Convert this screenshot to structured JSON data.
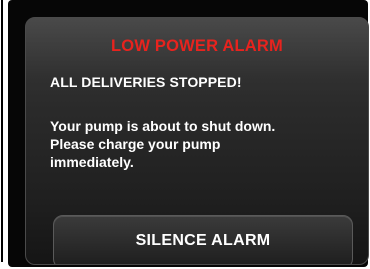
{
  "alarm": {
    "title": "LOW POWER ALARM",
    "title_color": "#e8231e",
    "subtitle": "ALL DELIVERIES STOPPED!",
    "message_lines": [
      "Your pump is about to shut down.",
      "Please charge your pump",
      "immediately."
    ]
  },
  "actions": {
    "silence_label": "SILENCE ALARM"
  }
}
